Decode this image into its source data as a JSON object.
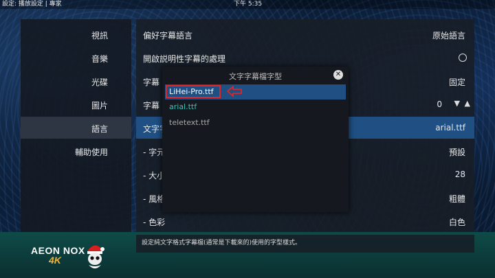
{
  "header": {
    "breadcrumb": "設定: 播放設定 | 專家",
    "clock": "下午 5:35"
  },
  "sidebar": {
    "items": [
      {
        "label": "視訊"
      },
      {
        "label": "音樂"
      },
      {
        "label": "光碟"
      },
      {
        "label": "圖片"
      },
      {
        "label": "語言",
        "active": true
      },
      {
        "label": "輔助使用"
      }
    ]
  },
  "settings": {
    "rows": [
      {
        "label": "偏好字幕語言",
        "value": "原始語言"
      },
      {
        "label": "開啟説明性字幕的處理",
        "control": "radio-icon"
      },
      {
        "label": "字幕",
        "value": "固定"
      },
      {
        "label": "字幕",
        "value": "0",
        "control": "spinner"
      },
      {
        "label": "文字字",
        "value": "arial.ttf",
        "active": true
      },
      {
        "label": "- 字元",
        "value": "預設"
      },
      {
        "label": "- 大小",
        "value": "28"
      },
      {
        "label": "- 風格",
        "value": "粗體"
      },
      {
        "label": "- 色彩",
        "value": "白色"
      }
    ],
    "spinner_down": "▼",
    "spinner_up": "▲"
  },
  "description": "設定純文字格式字幕檔(通常是下載來的)使用的字型樣式。",
  "dialog": {
    "title": "文字字幕檔字型",
    "close_glyph": "✕",
    "options": [
      {
        "label": "LiHei-Pro.ttf",
        "selected": true,
        "color": "#ffffff"
      },
      {
        "label": "arial.ttf",
        "color": "#29c7bd"
      },
      {
        "label": "teletext.ttf",
        "color": "#a8a8a8"
      }
    ]
  },
  "logo": {
    "brand": "AEON NOX",
    "sub": "4K",
    "icon": "skull-santa-icon"
  },
  "colors": {
    "selection": "#1f4f83",
    "annotation": "#e02626",
    "current_option": "#29c7bd"
  }
}
